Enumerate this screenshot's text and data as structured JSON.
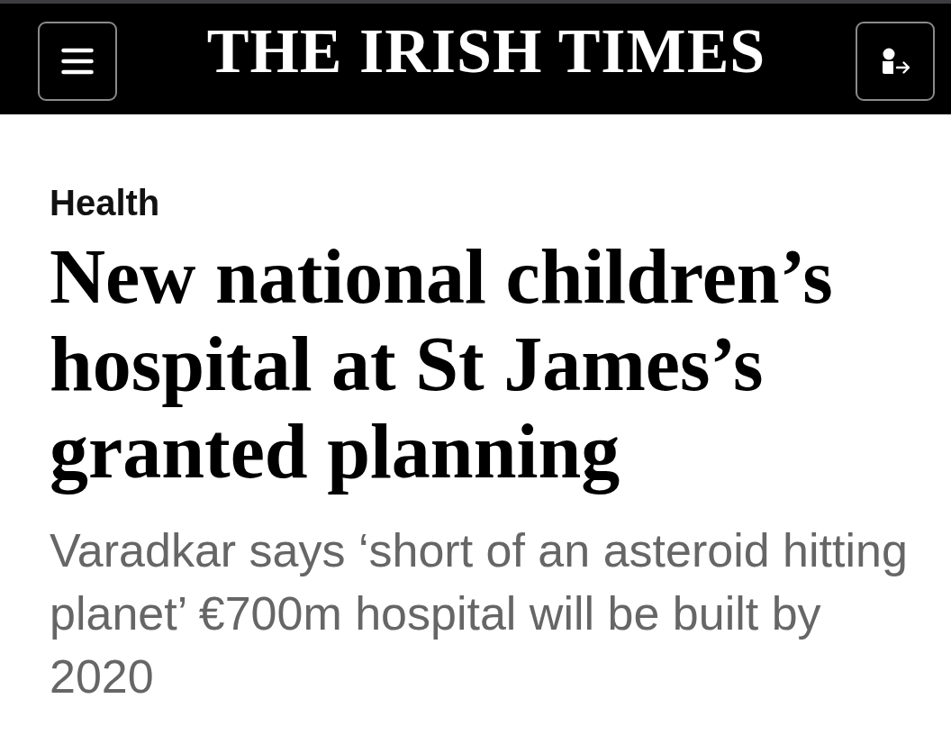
{
  "header": {
    "logo": "THE IRISH TIMES"
  },
  "article": {
    "section": "Health",
    "headline": "New national children’s hospital at St James’s granted planning",
    "standfirst": "Varadkar says ‘short of an asteroid hitting planet’ €700m hospital will be built by 2020"
  }
}
